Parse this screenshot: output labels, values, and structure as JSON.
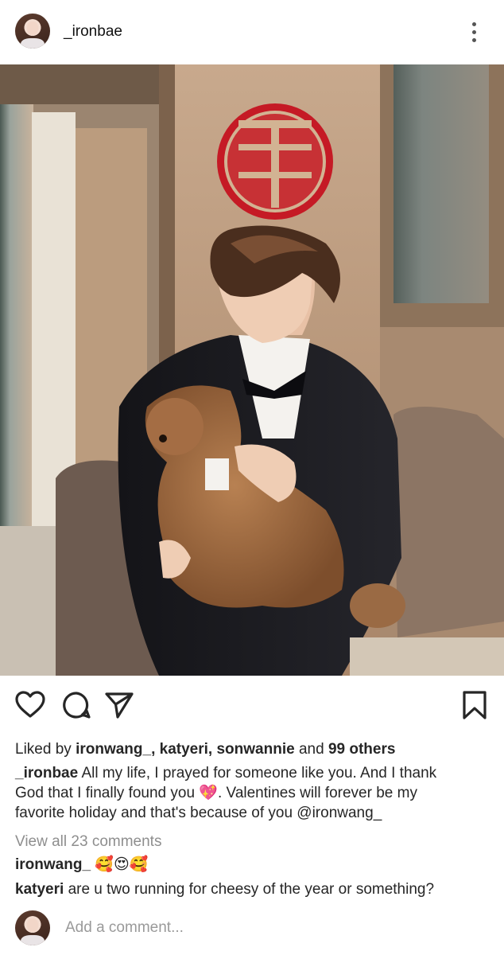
{
  "post": {
    "username": "_ironbae",
    "more_icon": "more-vertical-icon"
  },
  "actions": {
    "like_icon": "heart-icon",
    "comment_icon": "comment-icon",
    "share_icon": "share-icon",
    "save_icon": "bookmark-icon"
  },
  "likes": {
    "prefix": "Liked by",
    "users": [
      "ironwang_",
      "katyeri",
      "sonwannie"
    ],
    "separator": ",",
    "and_text": "and",
    "others": "99 others"
  },
  "caption": {
    "username": "_ironbae",
    "line1": "All my life, I prayed for someone like you. And I thank",
    "line2_start": "God that I finally found you",
    "line2_emoji": "💖",
    "line2_end": ". Valentines will forever be my",
    "line3": "favorite holiday and that's because of you @ironwang_"
  },
  "comments_link": "View all 23 comments",
  "comments": [
    {
      "username": "ironwang_",
      "text": "🥰😍🥰"
    },
    {
      "username": "katyeri",
      "text": "are u two running for cheesy of the year or something?"
    }
  ],
  "add_comment": {
    "placeholder": "Add a comment..."
  }
}
